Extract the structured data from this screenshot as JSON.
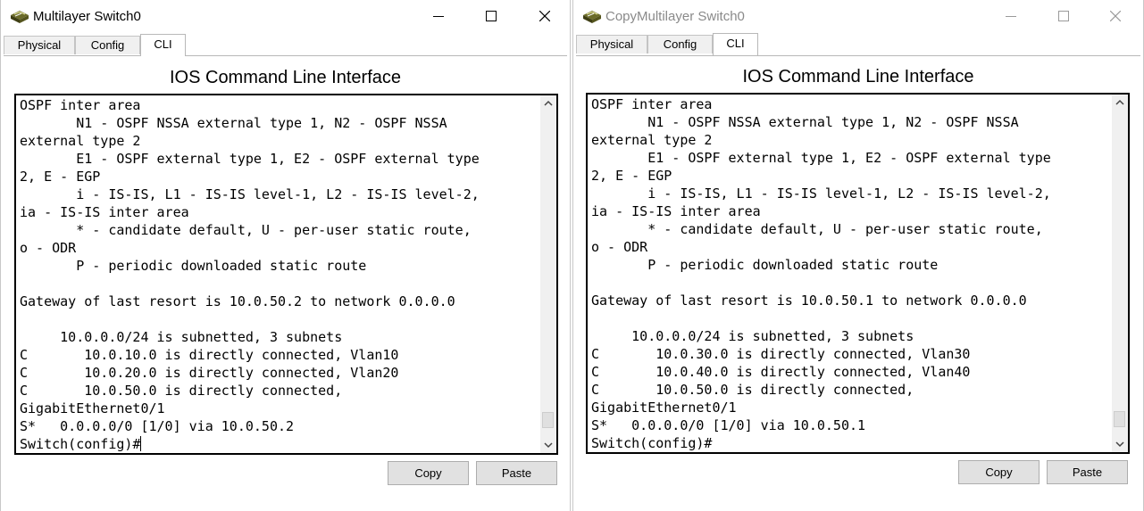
{
  "tab_labels": {
    "physical": "Physical",
    "config": "Config",
    "cli": "CLI"
  },
  "heading": "IOS Command Line Interface",
  "buttons": {
    "copy": "Copy",
    "paste": "Paste"
  },
  "windows": [
    {
      "title": "Multilayer Switch0",
      "active": true,
      "lines": [
        "OSPF inter area",
        "       N1 - OSPF NSSA external type 1, N2 - OSPF NSSA",
        "external type 2",
        "       E1 - OSPF external type 1, E2 - OSPF external type",
        "2, E - EGP",
        "       i - IS-IS, L1 - IS-IS level-1, L2 - IS-IS level-2,",
        "ia - IS-IS inter area",
        "       * - candidate default, U - per-user static route,",
        "o - ODR",
        "       P - periodic downloaded static route",
        "",
        "Gateway of last resort is 10.0.50.2 to network 0.0.0.0",
        "",
        "     10.0.0.0/24 is subnetted, 3 subnets",
        "C       10.0.10.0 is directly connected, Vlan10",
        "C       10.0.20.0 is directly connected, Vlan20",
        "C       10.0.50.0 is directly connected,",
        "GigabitEthernet0/1",
        "S*   0.0.0.0/0 [1/0] via 10.0.50.2",
        "Switch(config)#"
      ]
    },
    {
      "title": "CopyMultilayer Switch0",
      "active": false,
      "lines": [
        "OSPF inter area",
        "       N1 - OSPF NSSA external type 1, N2 - OSPF NSSA",
        "external type 2",
        "       E1 - OSPF external type 1, E2 - OSPF external type",
        "2, E - EGP",
        "       i - IS-IS, L1 - IS-IS level-1, L2 - IS-IS level-2,",
        "ia - IS-IS inter area",
        "       * - candidate default, U - per-user static route,",
        "o - ODR",
        "       P - periodic downloaded static route",
        "",
        "Gateway of last resort is 10.0.50.1 to network 0.0.0.0",
        "",
        "     10.0.0.0/24 is subnetted, 3 subnets",
        "C       10.0.30.0 is directly connected, Vlan30",
        "C       10.0.40.0 is directly connected, Vlan40",
        "C       10.0.50.0 is directly connected,",
        "GigabitEthernet0/1",
        "S*   0.0.0.0/0 [1/0] via 10.0.50.1",
        "Switch(config)#"
      ]
    }
  ]
}
